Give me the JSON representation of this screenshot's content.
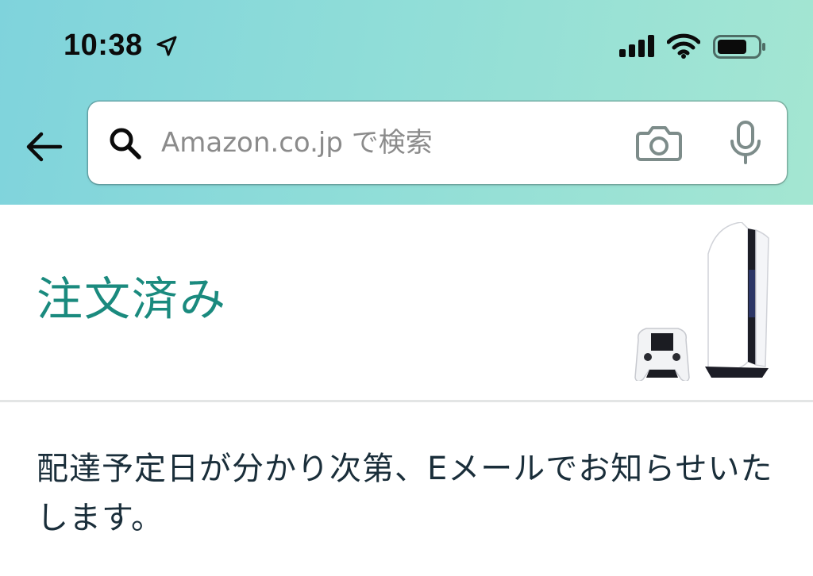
{
  "status_bar": {
    "time": "10:38",
    "icons": [
      "location-arrow-icon",
      "cellular-signal-icon",
      "wifi-icon",
      "battery-icon"
    ]
  },
  "header": {
    "back_icon": "arrow-left-icon",
    "search": {
      "placeholder": "Amazon.co.jp で検索",
      "search_icon": "search-icon",
      "camera_icon": "camera-icon",
      "mic_icon": "microphone-icon"
    }
  },
  "order": {
    "status_title": "注文済み",
    "product_image": "game-console-with-controller"
  },
  "message": {
    "text": "配達予定日が分かり次第、Eメールでお知らせいたします。"
  },
  "colors": {
    "accent_teal": "#1a8a7e",
    "header_gradient_start": "#7fd3dc",
    "header_gradient_end": "#a4e6d2",
    "body_text": "#1a2e3a",
    "placeholder_text": "#8b8b8b"
  }
}
